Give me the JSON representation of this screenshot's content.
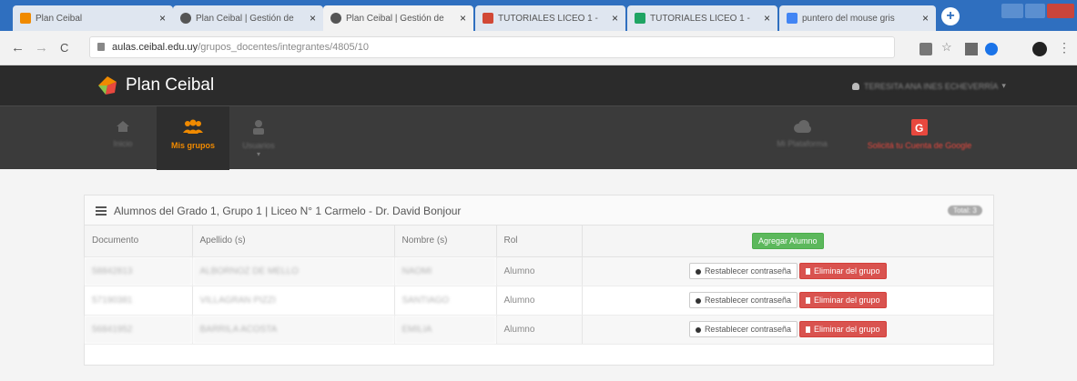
{
  "browser": {
    "tabs": [
      {
        "title": "Plan Ceibal",
        "favicon_color": "#f08a00"
      },
      {
        "title": "Plan Ceibal | Gestión de",
        "favicon_color": "#555555"
      },
      {
        "title": "Plan Ceibal | Gestión de",
        "favicon_color": "#555555"
      },
      {
        "title": "TUTORIALES LICEO 1 -",
        "favicon_color": "#d14836"
      },
      {
        "title": "TUTORIALES LICEO 1 -",
        "favicon_color": "#1fa463"
      },
      {
        "title": "puntero del mouse gris",
        "favicon_color": "#4285f4"
      }
    ],
    "new_tab": "+",
    "url_host": "aulas.ceibal.edu.uy",
    "url_path": "/grupos_docentes/integrantes/4805/10",
    "nav": {
      "back": "←",
      "forward": "→",
      "reload": "C"
    }
  },
  "app": {
    "brand": "Plan Ceibal",
    "user": "TERESITA ANA INES ECHEVERRÍA",
    "nav": [
      {
        "label": "Inicio",
        "icon": "home-icon"
      },
      {
        "label": "Mis grupos",
        "icon": "users-icon"
      },
      {
        "label": "Usuarios",
        "icon": "user-icon"
      },
      {
        "label": "Mi Plataforma",
        "icon": "cloud-icon"
      },
      {
        "label": "Solicitá tu Cuenta de Google",
        "icon": "google-icon"
      }
    ],
    "colors": {
      "accent": "#f08a00",
      "google": "#e8483e",
      "success": "#5cb85c",
      "danger": "#d9534f"
    }
  },
  "panel": {
    "title": "Alumnos del Grado 1, Grupo 1 | Liceo N° 1 Carmelo - Dr. David Bonjour",
    "count_badge": "Total: 3",
    "columns": [
      "Documento",
      "Apellido (s)",
      "Nombre (s)",
      "Rol"
    ],
    "add_button": "Agregar Alumno",
    "reset_button": "Restablecer contraseña",
    "remove_button": "Eliminar del grupo",
    "rows": [
      {
        "documento": "58842813",
        "apellido": "ALBORNOZ DE MELLO",
        "nombre": "NAOMI",
        "rol": "Alumno"
      },
      {
        "documento": "57190381",
        "apellido": "VILLAGRAN PIZZI",
        "nombre": "SANTIAGO",
        "rol": "Alumno"
      },
      {
        "documento": "56841952",
        "apellido": "BARRILA ACOSTA",
        "nombre": "EMILIA",
        "rol": "Alumno"
      }
    ]
  }
}
